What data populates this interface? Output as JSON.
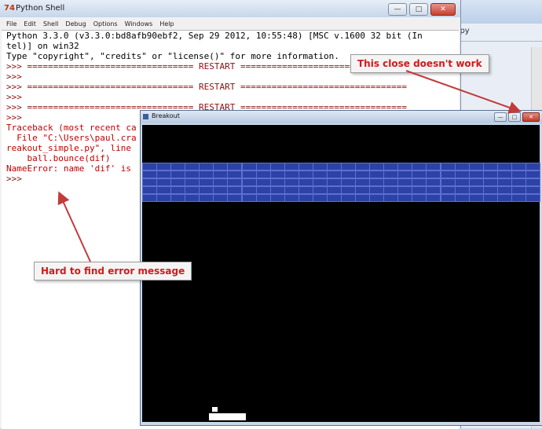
{
  "background_window": {
    "tab_label": "ple.py"
  },
  "shell": {
    "app_icon": "74",
    "title": "Python Shell",
    "menu": [
      "File",
      "Edit",
      "Shell",
      "Debug",
      "Options",
      "Windows",
      "Help"
    ],
    "lines": [
      {
        "text": "Python 3.3.0 (v3.3.0:bd8afb90ebf2, Sep 29 2012, 10:55:48) [MSC v.1600 32 bit (In",
        "style": "normal"
      },
      {
        "text": "tel)] on win32",
        "style": "normal"
      },
      {
        "text": "Type \"copyright\", \"credits\" or \"license()\" for more information.",
        "style": "normal"
      },
      {
        "text": ">>> ================================ RESTART ================================",
        "style": "prompt"
      },
      {
        "text": ">>>",
        "style": "prompt"
      },
      {
        "text": ">>> ================================ RESTART ================================",
        "style": "prompt"
      },
      {
        "text": ">>>",
        "style": "prompt"
      },
      {
        "text": ">>> ================================ RESTART ================================",
        "style": "prompt"
      },
      {
        "text": ">>>",
        "style": "prompt"
      },
      {
        "text": "Traceback (most recent ca",
        "style": "err"
      },
      {
        "text": "  File \"C:\\Users\\paul.cra",
        "style": "err"
      },
      {
        "text": "reakout_simple.py\", line",
        "style": "err"
      },
      {
        "text": "    ball.bounce(dif)",
        "style": "err"
      },
      {
        "text": "NameError: name 'dif' is",
        "style": "err"
      },
      {
        "text": ">>>",
        "style": "prompt"
      }
    ]
  },
  "breakout": {
    "title": "Breakout",
    "brick_rows": 5,
    "brick_cols": 28,
    "colors": {
      "brick": "#2d42a6",
      "background": "#000000",
      "paddle": "#ffffff"
    }
  },
  "annotations": {
    "close_note": "This close doesn't work",
    "error_note": "Hard to find error message"
  },
  "window_buttons": {
    "minimize": "—",
    "maximize": "□",
    "close": "✕"
  }
}
